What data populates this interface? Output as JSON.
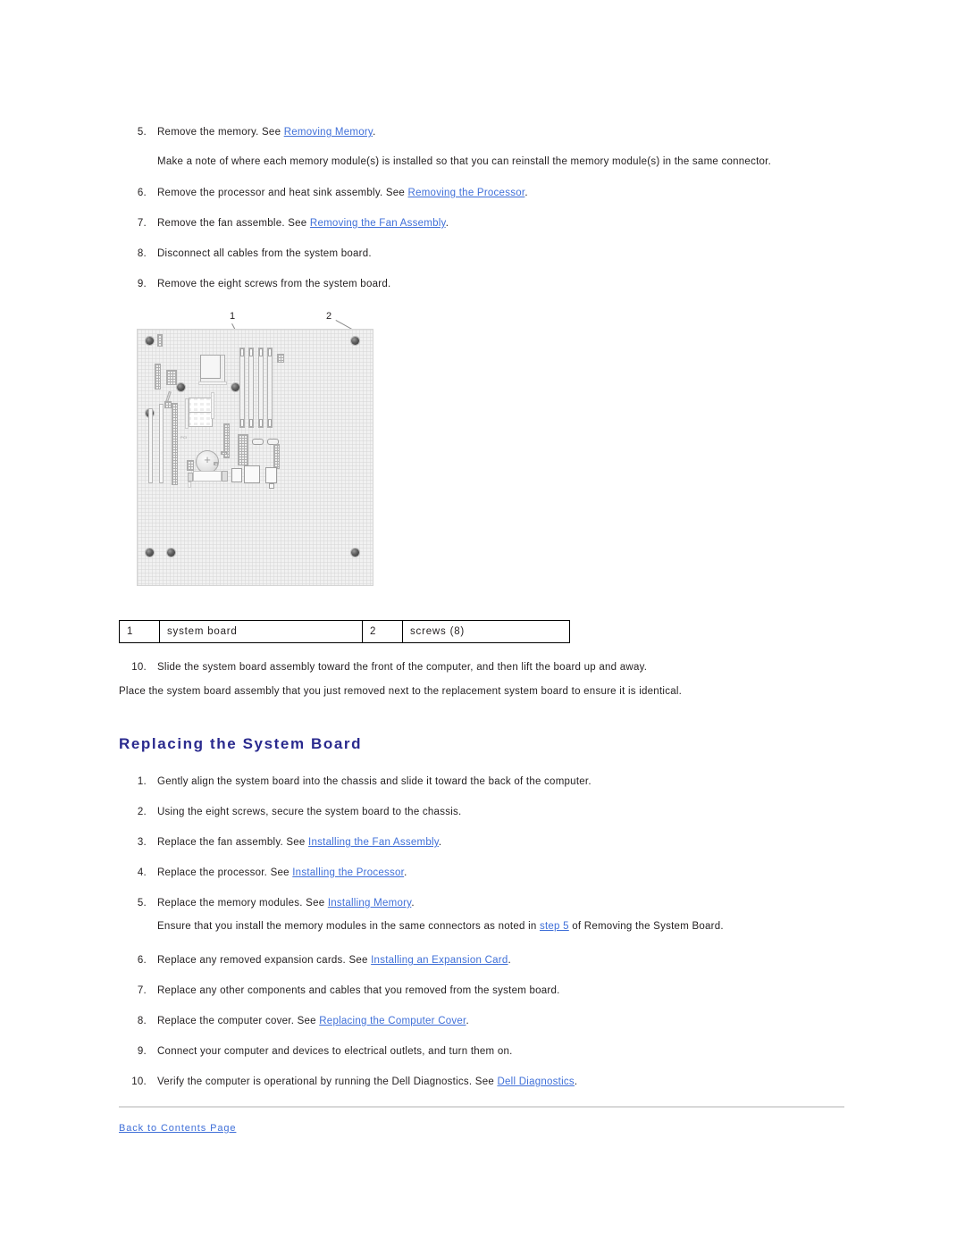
{
  "document": {
    "removal_steps": [
      {
        "num": "5.",
        "parts": [
          {
            "t": "Remove the memory. See ",
            "link": false
          },
          {
            "t": "Removing Memory",
            "link": true
          },
          {
            "t": ".",
            "link": false
          }
        ]
      },
      {
        "num": "6.",
        "parts": [
          {
            "t": "Remove the processor and heat sink assembly. See ",
            "link": false
          },
          {
            "t": "Removing the Processor",
            "link": true
          },
          {
            "t": ".",
            "link": false
          }
        ]
      },
      {
        "num": "7.",
        "parts": [
          {
            "t": "Remove the fan assemble. See ",
            "link": false
          },
          {
            "t": "Removing the Fan Assembly",
            "link": true
          },
          {
            "t": ".",
            "link": false
          }
        ]
      },
      {
        "num": "8.",
        "parts": [
          {
            "t": "Disconnect all cables from the system board.",
            "link": false
          }
        ]
      },
      {
        "num": "9.",
        "parts": [
          {
            "t": "Remove the eight screws from the system board.",
            "link": false
          }
        ]
      },
      {
        "num": "10.",
        "parts": [
          {
            "t": "Slide the system board assembly toward the front of the computer, and then lift the board up and away.",
            "link": false
          }
        ]
      }
    ],
    "note_after_step5": "Make a note of where each memory module(s) is installed so that you can reinstall the memory module(s) in the same connector.",
    "note_after_step10": "Place the system board assembly that you just removed next to the replacement system board to ensure it is identical.",
    "section_heading": "Replacing the System Board",
    "replacing_steps": [
      {
        "num": "1.",
        "parts": [
          {
            "t": "Gently align the system board into the chassis and slide it toward the back of the computer.",
            "link": false
          }
        ]
      },
      {
        "num": "2.",
        "parts": [
          {
            "t": "Using the eight screws, secure the system board to the chassis.",
            "link": false
          }
        ]
      },
      {
        "num": "3.",
        "parts": [
          {
            "t": "Replace the fan assembly. See ",
            "link": false
          },
          {
            "t": "Installing the Fan Assembly",
            "link": true
          },
          {
            "t": ".",
            "link": false
          }
        ]
      },
      {
        "num": "4.",
        "parts": [
          {
            "t": "Replace the processor. See ",
            "link": false
          },
          {
            "t": "Installing the Processor",
            "link": true
          },
          {
            "t": ".",
            "link": false
          }
        ]
      },
      {
        "num": "5.",
        "parts": [
          {
            "t": "Replace the memory modules. See ",
            "link": false
          },
          {
            "t": "Installing Memory",
            "link": true
          },
          {
            "t": ".",
            "link": false
          }
        ]
      },
      {
        "num": "6.",
        "parts": [
          {
            "t": "Replace any removed expansion cards. See ",
            "link": false
          },
          {
            "t": "Installing an Expansion Card",
            "link": true
          },
          {
            "t": ".",
            "link": false
          }
        ]
      },
      {
        "num": "7.",
        "parts": [
          {
            "t": "Replace any other components and cables that you removed from the system board.",
            "link": false
          }
        ]
      },
      {
        "num": "8.",
        "parts": [
          {
            "t": "Replace the computer cover. See ",
            "link": false
          },
          {
            "t": "Replacing the Computer Cover",
            "link": true
          },
          {
            "t": ".",
            "link": false
          }
        ]
      },
      {
        "num": "9.",
        "parts": [
          {
            "t": "Connect your computer and devices to electrical outlets, and turn them on.",
            "link": false
          }
        ]
      },
      {
        "num": "10.",
        "parts": [
          {
            "t": "Verify the computer is operational by running the Dell Diagnostics. See ",
            "link": false
          },
          {
            "t": "Dell Diagnostics",
            "link": true
          },
          {
            "t": ".",
            "link": false
          }
        ]
      }
    ],
    "note_after_replace_step5": [
      {
        "t": "Ensure that you install the memory modules in the same connectors as noted in ",
        "link": false
      },
      {
        "t": "step 5",
        "link": true
      },
      {
        "t": " of Removing the System Board.",
        "link": false
      }
    ],
    "footer_link": "Back to Contents Page"
  },
  "figure": {
    "callouts": [
      {
        "id": "1",
        "label": "system board"
      },
      {
        "id": "2",
        "label": "screws (8)"
      }
    ],
    "legend_rows": [
      {
        "idx": "1",
        "label": "system board",
        "idx2": "2",
        "label2": "screws (8)"
      }
    ]
  },
  "colors": {
    "link": "#3f6fd8",
    "heading": "#2a2a8e",
    "text": "#231f20",
    "board_fill": "#f1f1f1",
    "rule": "#d8d8d8"
  }
}
